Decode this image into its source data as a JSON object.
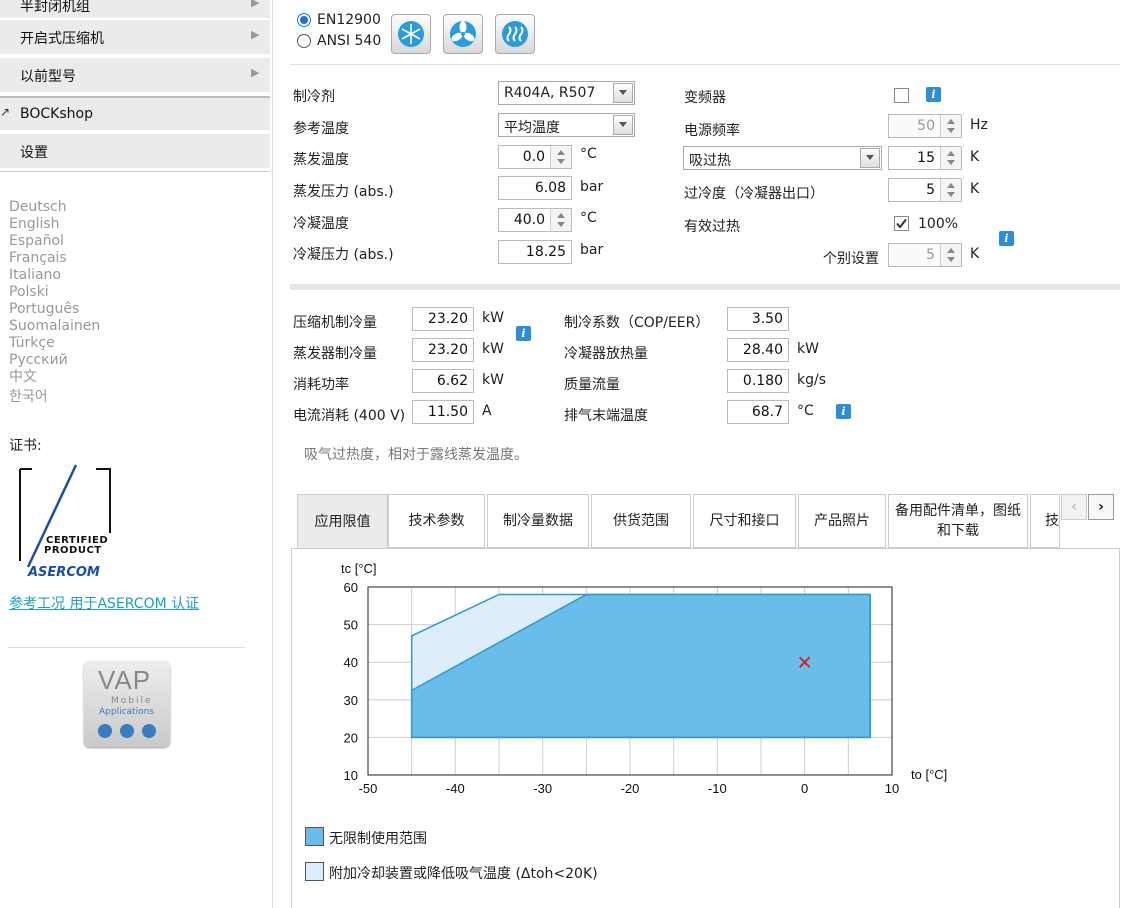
{
  "sidebar": {
    "items": [
      {
        "label": "半封闭机组",
        "arrow": true
      },
      {
        "label": "开启式压缩机",
        "arrow": true
      },
      {
        "label": "以前型号",
        "arrow": true
      },
      {
        "label": "BOCKshop",
        "arrow": false
      },
      {
        "label": "设置",
        "arrow": false
      }
    ],
    "languages": [
      "Deutsch",
      "English",
      "Español",
      "Français",
      "Italiano",
      "Polski",
      "Português",
      "Suomalainen",
      "Türkçe",
      "Русский",
      "中文",
      "한국어"
    ],
    "cert_label": "证书:",
    "cert_logo": {
      "line1": "CERTIFIED",
      "line2": "PRODUCT",
      "line3": "ASERCOM"
    },
    "asercom_link": "参考工况 用于ASERCOM 认证",
    "vap_logo": {
      "title": "VAP",
      "sub1": "Mobile",
      "sub2": "Applications"
    }
  },
  "standard": {
    "options": [
      "EN12900",
      "ANSI 540"
    ],
    "selected": "EN12900",
    "icons": [
      "snowflake-icon",
      "fan-icon",
      "heat-icon"
    ]
  },
  "params": {
    "refrigerant_label": "制冷剂",
    "refrigerant": "R404A, R507",
    "reftemp_label": "参考温度",
    "reftemp": "平均温度",
    "evap_temp_label": "蒸发温度",
    "evap_temp": "0.0",
    "evap_temp_unit": "°C",
    "evap_press_label": "蒸发压力 (abs.)",
    "evap_press": "6.08",
    "evap_press_unit": "bar",
    "cond_temp_label": "冷凝温度",
    "cond_temp": "40.0",
    "cond_temp_unit": "°C",
    "cond_press_label": "冷凝压力 (abs.)",
    "cond_press": "18.25",
    "cond_press_unit": "bar",
    "inverter_label": "变频器",
    "freq_label": "电源频率",
    "freq": "50",
    "freq_unit": "Hz",
    "superheat_select": "吸过热",
    "superheat": "15",
    "superheat_unit": "K",
    "subcool_label": "过冷度（冷凝器出口）",
    "subcool": "5",
    "subcool_unit": "K",
    "eff_superheat_label": "有效过热",
    "eff_superheat": "100%",
    "individual_label": "个别设置",
    "individual": "5",
    "individual_unit": "K"
  },
  "results": {
    "comp_cap_label": "压缩机制冷量",
    "comp_cap": "23.20",
    "comp_cap_unit": "kW",
    "evap_cap_label": "蒸发器制冷量",
    "evap_cap": "23.20",
    "evap_cap_unit": "kW",
    "power_label": "消耗功率",
    "power": "6.62",
    "power_unit": "kW",
    "current_label": "电流消耗 (400 V)",
    "current": "11.50",
    "current_unit": "A",
    "cop_label": "制冷系数（COP/EER）",
    "cop": "3.50",
    "cond_rej_label": "冷凝器放热量",
    "cond_rej": "28.40",
    "cond_rej_unit": "kW",
    "mass_label": "质量流量",
    "mass": "0.180",
    "mass_unit": "kg/s",
    "discharge_label": "排气末端温度",
    "discharge": "68.7",
    "discharge_unit": "°C",
    "note": "吸气过热度，相对于露线蒸发温度。"
  },
  "tabs": [
    {
      "label": "应用限值",
      "active": true
    },
    {
      "label": "技术参数"
    },
    {
      "label": "制冷量数据"
    },
    {
      "label": "供货范围"
    },
    {
      "label": "尺寸和接口"
    },
    {
      "label": "产品照片"
    },
    {
      "label": "备用配件清单，图纸和下载"
    },
    {
      "label": "技"
    }
  ],
  "chart_data": {
    "type": "area",
    "ylabel": "tc [°C]",
    "xlabel": "to [°C]",
    "xlim": [
      -50,
      10
    ],
    "ylim": [
      10,
      60
    ],
    "xticks": [
      -50,
      -40,
      -30,
      -20,
      -10,
      0,
      10
    ],
    "yticks": [
      10,
      20,
      30,
      40,
      50,
      60
    ],
    "grid": true,
    "series": [
      {
        "name": "附加冷却装置或降低吸气温度 (Δtoh<20K)",
        "color": "#ddeefa",
        "polygon": [
          [
            -45,
            20
          ],
          [
            -45,
            47
          ],
          [
            -35,
            58
          ],
          [
            7.5,
            58
          ],
          [
            7.5,
            20
          ]
        ]
      },
      {
        "name": "无限制使用范围",
        "color": "#68bdea",
        "polygon": [
          [
            -45,
            20
          ],
          [
            -45,
            32.5
          ],
          [
            -25,
            58
          ],
          [
            7.5,
            58
          ],
          [
            7.5,
            20
          ]
        ]
      }
    ],
    "operating_point": {
      "x": 0,
      "y": 40,
      "marker": "×",
      "color": "#e02020"
    },
    "legend": [
      {
        "label": "无限制使用范围",
        "color": "#68bdea"
      },
      {
        "label": "附加冷却装置或降低吸气温度 (Δtoh<20K)",
        "color": "#ddeefa"
      }
    ]
  }
}
